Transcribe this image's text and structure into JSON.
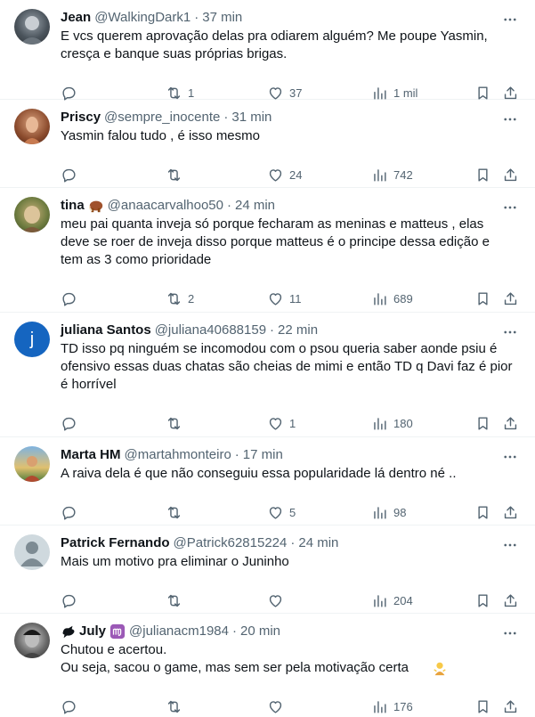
{
  "tweets": [
    {
      "name": "Jean",
      "handle": "@WalkingDark1",
      "time": "37 min",
      "text": "E vcs querem aprovação delas pra odiarem alguém? Me poupe Yasmin,\ncresça e banque suas próprias brigas.",
      "replies": "",
      "retweets": "1",
      "likes": "37",
      "views": "1 mil"
    },
    {
      "name": "Priscy",
      "handle": "@sempre_inocente",
      "time": "31 min",
      "text": "Yasmin falou tudo , é isso mesmo",
      "replies": "",
      "retweets": "",
      "likes": "24",
      "views": "742"
    },
    {
      "name": "tina",
      "handle": "@anaacarvalhoo50",
      "time": "24 min",
      "text": "meu pai quanta inveja só porque fecharam as meninas e matteus , elas\ndeve se roer de inveja disso porque matteus é o principe dessa edição e\ntem as 3 como prioridade",
      "replies": "",
      "retweets": "2",
      "likes": "11",
      "views": "689"
    },
    {
      "name": "juliana Santos",
      "handle": "@juliana40688159",
      "time": "22 min",
      "text": "TD isso pq ninguém se incomodou com o psou queria saber aonde psiu é\nofensivo essas duas chatas são cheias de mimi e então TD q Davi faz é pior\né horrível",
      "replies": "",
      "retweets": "",
      "likes": "1",
      "views": "180"
    },
    {
      "name": "Marta HM",
      "handle": "@martahmonteiro",
      "time": "17 min",
      "text": "A raiva dela é que não conseguiu essa popularidade lá dentro né ..",
      "replies": "",
      "retweets": "",
      "likes": "5",
      "views": "98"
    },
    {
      "name": "Patrick Fernando",
      "handle": "@Patrick62815224",
      "time": "24 min",
      "text": "Mais um motivo pra eliminar o Juninho",
      "replies": "",
      "retweets": "",
      "likes": "",
      "views": "204"
    },
    {
      "name": "July",
      "handle": "@julianacm1984",
      "time": "20 min",
      "text": "Chutou e acertou.\nOu seja, sacou o game, mas sem ser pela motivação certa",
      "replies": "",
      "retweets": "",
      "likes": "",
      "views": "176"
    }
  ],
  "separator": "·",
  "colors": {
    "text": "#0f1419",
    "secondary": "#536471",
    "border": "#eff3f4",
    "twitter_blue": "#1d9bf0"
  },
  "icons": [
    "reply-icon",
    "retweet-icon",
    "like-icon",
    "views-icon",
    "bookmark-icon",
    "share-icon",
    "more-icon"
  ]
}
